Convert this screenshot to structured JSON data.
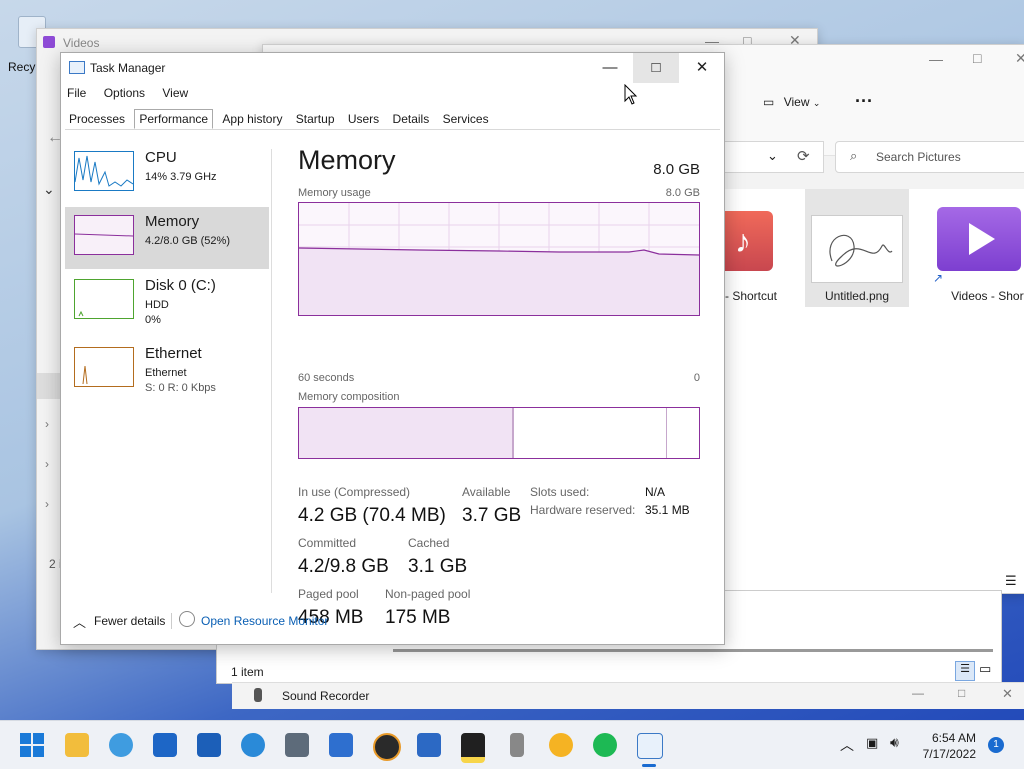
{
  "desktop": {
    "recycle_label": "Recy"
  },
  "videos_window": {
    "title": "Videos"
  },
  "explorer": {
    "view_label": "View",
    "more_label": "···",
    "search_placeholder": "Search Pictures",
    "files": [
      {
        "label": "- Shortcut"
      },
      {
        "label": "Untitled.png"
      },
      {
        "label": "Videos - Shortcut"
      }
    ],
    "status": "1 item",
    "left_count": "2 i"
  },
  "sound_recorder": {
    "title": "Sound Recorder"
  },
  "task_manager": {
    "title": "Task Manager",
    "menu": [
      "File",
      "Options",
      "View"
    ],
    "tabs": [
      "Processes",
      "Performance",
      "App history",
      "Startup",
      "Users",
      "Details",
      "Services"
    ],
    "sidebar": [
      {
        "name": "CPU",
        "line1": "14% 3.79 GHz",
        "line2": ""
      },
      {
        "name": "Memory",
        "line1": "4.2/8.0 GB (52%)",
        "line2": ""
      },
      {
        "name": "Disk 0 (C:)",
        "line1": "HDD",
        "line2": "0%"
      },
      {
        "name": "Ethernet",
        "line1": "Ethernet",
        "line2": "S: 0 R: 0 Kbps"
      }
    ],
    "main": {
      "title": "Memory",
      "capacity": "8.0 GB",
      "usage_label": "Memory usage",
      "usage_max": "8.0 GB",
      "time_label": "60 seconds",
      "time_end": "0",
      "composition_label": "Memory composition",
      "in_use_label": "In use (Compressed)",
      "in_use_value": "4.2 GB (70.4 MB)",
      "available_label": "Available",
      "available_value": "3.7 GB",
      "slots_label": "Slots used:",
      "slots_value": "N/A",
      "hw_label": "Hardware reserved:",
      "hw_value": "35.1 MB",
      "committed_label": "Committed",
      "committed_value": "4.2/9.8 GB",
      "cached_label": "Cached",
      "cached_value": "3.1 GB",
      "paged_label": "Paged pool",
      "paged_value": "458 MB",
      "nonpaged_label": "Non-paged pool",
      "nonpaged_value": "175 MB"
    },
    "footer": {
      "fewer": "Fewer details",
      "resmon": "Open Resource Monitor"
    }
  },
  "taskbar": {
    "time": "6:54 AM",
    "date": "7/17/2022",
    "notif": "1"
  }
}
